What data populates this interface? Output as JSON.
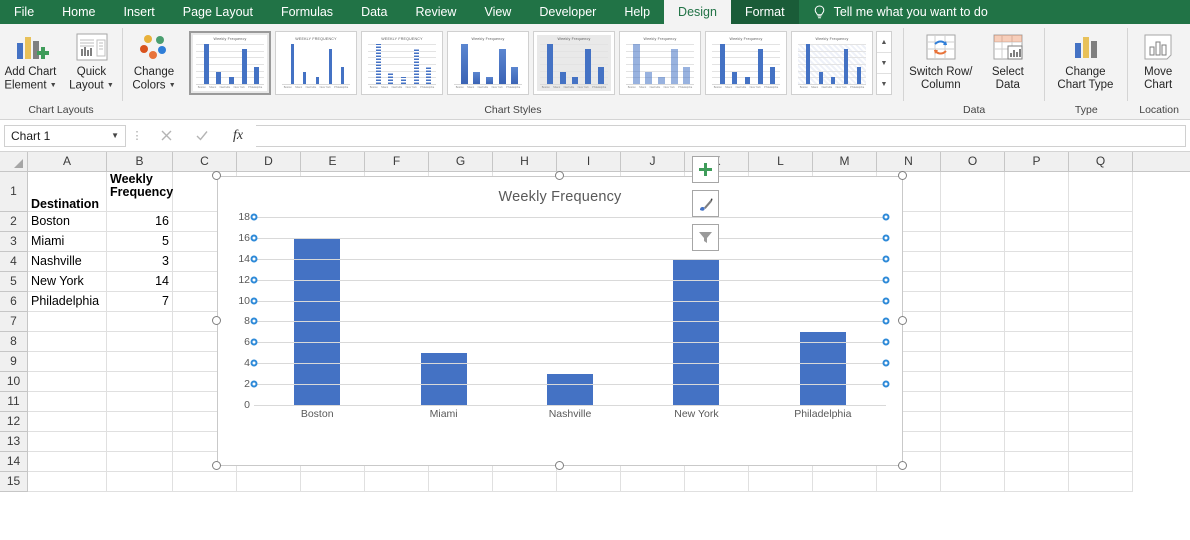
{
  "ribbon": {
    "tabs": [
      {
        "label": "File",
        "state": "normal"
      },
      {
        "label": "Home",
        "state": "normal"
      },
      {
        "label": "Insert",
        "state": "normal"
      },
      {
        "label": "Page Layout",
        "state": "normal"
      },
      {
        "label": "Formulas",
        "state": "normal"
      },
      {
        "label": "Data",
        "state": "normal"
      },
      {
        "label": "Review",
        "state": "normal"
      },
      {
        "label": "View",
        "state": "normal"
      },
      {
        "label": "Developer",
        "state": "normal"
      },
      {
        "label": "Help",
        "state": "normal"
      },
      {
        "label": "Design",
        "state": "active"
      },
      {
        "label": "Format",
        "state": "contextual"
      }
    ],
    "tellme": {
      "label": "Tell me what you want to do",
      "icon": "lightbulb-icon"
    },
    "groups": [
      {
        "name": "Chart Layouts",
        "label": "Chart Layouts",
        "buttons": [
          {
            "label": "Add Chart\nElement",
            "icon": "add-chart-element-icon",
            "dropdown": true
          },
          {
            "label": "Quick\nLayout",
            "icon": "quick-layout-icon",
            "dropdown": true
          }
        ]
      },
      {
        "name": "Chart Styles",
        "label": "Chart Styles",
        "buttons": [
          {
            "label": "Change\nColors",
            "icon": "change-colors-icon",
            "dropdown": true
          }
        ],
        "gallery_title": "Weekly Frequency",
        "gallery_scroll": [
          "scroll-up",
          "scroll-down",
          "more-styles"
        ]
      },
      {
        "name": "Data",
        "label": "Data",
        "buttons": [
          {
            "label": "Switch Row/\nColumn",
            "icon": "switch-row-column-icon",
            "dropdown": false
          },
          {
            "label": "Select\nData",
            "icon": "select-data-icon",
            "dropdown": false
          }
        ]
      },
      {
        "name": "Type",
        "label": "Type",
        "buttons": [
          {
            "label": "Change\nChart Type",
            "icon": "change-chart-type-icon",
            "dropdown": false
          }
        ]
      },
      {
        "name": "Location",
        "label": "Location",
        "buttons": [
          {
            "label": "Move\nChart",
            "icon": "move-chart-icon",
            "dropdown": false
          }
        ]
      }
    ]
  },
  "formula_bar": {
    "name_box_value": "Chart 1",
    "formula_value": "",
    "cancel_icon": "close-icon",
    "enter_icon": "check-icon",
    "function_icon": "fx-icon"
  },
  "grid": {
    "column_headers": [
      "A",
      "B",
      "C",
      "D",
      "E",
      "F",
      "G",
      "H",
      "I",
      "J",
      "K",
      "L",
      "M",
      "N",
      "O",
      "P",
      "Q"
    ],
    "row_headers": [
      "1",
      "2",
      "3",
      "4",
      "5",
      "6",
      "7",
      "8",
      "9",
      "10",
      "11",
      "12",
      "13",
      "14",
      "15"
    ],
    "cells": {
      "A1": "Destination",
      "B1": "Weekly Frequency",
      "A2": "Boston",
      "B2": "16",
      "A3": "Miami",
      "B3": "5",
      "A4": "Nashville",
      "B4": "3",
      "A5": "New York",
      "B5": "14",
      "A6": "Philadelphia",
      "B6": "7"
    }
  },
  "chart": {
    "selected": true,
    "buttons": [
      {
        "name": "chart-elements-button",
        "icon": "plus-icon"
      },
      {
        "name": "chart-styles-button",
        "icon": "paintbrush-icon"
      },
      {
        "name": "chart-filters-button",
        "icon": "funnel-icon"
      }
    ]
  },
  "chart_data": {
    "type": "bar",
    "title": "Weekly Frequency",
    "categories": [
      "Boston",
      "Miami",
      "Nashville",
      "New York",
      "Philadelphia"
    ],
    "values": [
      16,
      5,
      3,
      14,
      7
    ],
    "series": [
      {
        "name": "Weekly Frequency",
        "values": [
          16,
          5,
          3,
          14,
          7
        ],
        "color": "#4472C4"
      }
    ],
    "xlabel": "",
    "ylabel": "",
    "ylim": [
      0,
      18
    ],
    "ytick_step": 2,
    "yticks": [
      0,
      2,
      4,
      6,
      8,
      10,
      12,
      14,
      16,
      18
    ],
    "grid": true,
    "legend": false,
    "gridline_color": "#D9D9D9",
    "title_color": "#595959",
    "label_color": "#595959"
  }
}
